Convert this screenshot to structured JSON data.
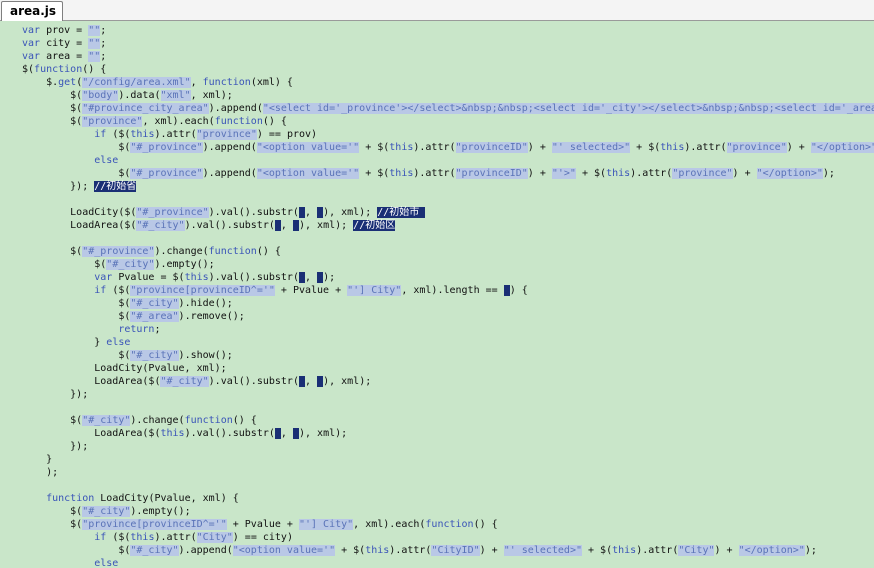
{
  "tab": {
    "title": "area.js"
  },
  "editor": {
    "lines": [
      [
        [
          "k",
          "var"
        ],
        [
          "p",
          " prov = "
        ],
        [
          "s",
          "\"\""
        ],
        [
          "p",
          ";"
        ]
      ],
      [
        [
          "k",
          "var"
        ],
        [
          "p",
          " city = "
        ],
        [
          "s",
          "\"\""
        ],
        [
          "p",
          ";"
        ]
      ],
      [
        [
          "k",
          "var"
        ],
        [
          "p",
          " area = "
        ],
        [
          "s",
          "\"\""
        ],
        [
          "p",
          ";"
        ]
      ],
      [
        [
          "p",
          "$("
        ],
        [
          "k",
          "function"
        ],
        [
          "p",
          "() {"
        ]
      ],
      [
        [
          "p",
          "    $."
        ],
        [
          "k",
          "get"
        ],
        [
          "p",
          "("
        ],
        [
          "s",
          "\"/config/area.xml\""
        ],
        [
          "p",
          ", "
        ],
        [
          "k",
          "function"
        ],
        [
          "p",
          "(xml) {"
        ]
      ],
      [
        [
          "p",
          "        $("
        ],
        [
          "s",
          "\"body\""
        ],
        [
          "p",
          ").data("
        ],
        [
          "s",
          "\"xml\""
        ],
        [
          "p",
          ", xml);"
        ]
      ],
      [
        [
          "p",
          "        $("
        ],
        [
          "s",
          "\"#province_city_area\""
        ],
        [
          "p",
          ").append("
        ],
        [
          "s",
          "\"<select id='_province'></select>&nbsp;&nbsp;<select id='_city'></select>&nbsp;&nbsp;<select id='_area'"
        ]
      ],
      [
        [
          "p",
          "        $("
        ],
        [
          "s",
          "\"province\""
        ],
        [
          "p",
          ", xml).each("
        ],
        [
          "k",
          "function"
        ],
        [
          "p",
          "() {"
        ]
      ],
      [
        [
          "p",
          "            "
        ],
        [
          "k",
          "if"
        ],
        [
          "p",
          " ($("
        ],
        [
          "k",
          "this"
        ],
        [
          "p",
          ").attr("
        ],
        [
          "s",
          "\"province\""
        ],
        [
          "p",
          ") == prov)"
        ]
      ],
      [
        [
          "p",
          "                $("
        ],
        [
          "s",
          "\"#_province\""
        ],
        [
          "p",
          ").append("
        ],
        [
          "s",
          "\"<option value='\""
        ],
        [
          "p",
          " + $("
        ],
        [
          "k",
          "this"
        ],
        [
          "p",
          ").attr("
        ],
        [
          "s",
          "\"provinceID\""
        ],
        [
          "p",
          ") + "
        ],
        [
          "s",
          "\"' selected>\""
        ],
        [
          "p",
          " + $("
        ],
        [
          "k",
          "this"
        ],
        [
          "p",
          ").attr("
        ],
        [
          "s",
          "\"province\""
        ],
        [
          "p",
          ") + "
        ],
        [
          "s",
          "\"</option>\""
        ],
        [
          "p",
          ");"
        ]
      ],
      [
        [
          "p",
          "            "
        ],
        [
          "k",
          "else"
        ]
      ],
      [
        [
          "p",
          "                $("
        ],
        [
          "s",
          "\"#_province\""
        ],
        [
          "p",
          ").append("
        ],
        [
          "s",
          "\"<option value='\""
        ],
        [
          "p",
          " + $("
        ],
        [
          "k",
          "this"
        ],
        [
          "p",
          ").attr("
        ],
        [
          "s",
          "\"provinceID\""
        ],
        [
          "p",
          ") + "
        ],
        [
          "s",
          "\"'>\""
        ],
        [
          "p",
          " + $("
        ],
        [
          "k",
          "this"
        ],
        [
          "p",
          ").attr("
        ],
        [
          "s",
          "\"province\""
        ],
        [
          "p",
          ") + "
        ],
        [
          "s",
          "\"</option>\""
        ],
        [
          "p",
          ");"
        ]
      ],
      [
        [
          "p",
          "        }); "
        ],
        [
          "cm",
          "//初始省"
        ]
      ],
      [],
      [
        [
          "p",
          "        LoadCity($("
        ],
        [
          "s",
          "\"#_province\""
        ],
        [
          "p",
          ").val().substr("
        ],
        [
          "m",
          "0"
        ],
        [
          "p",
          ", "
        ],
        [
          "m",
          "2"
        ],
        [
          "p",
          "), xml); "
        ],
        [
          "cm",
          "//初始市 "
        ]
      ],
      [
        [
          "p",
          "        LoadArea($("
        ],
        [
          "s",
          "\"#_city\""
        ],
        [
          "p",
          ").val().substr("
        ],
        [
          "m",
          "0"
        ],
        [
          "p",
          ", "
        ],
        [
          "m",
          "4"
        ],
        [
          "p",
          "), xml); "
        ],
        [
          "cm",
          "//初始区"
        ]
      ],
      [],
      [
        [
          "p",
          "        $("
        ],
        [
          "s",
          "\"#_province\""
        ],
        [
          "p",
          ").change("
        ],
        [
          "k",
          "function"
        ],
        [
          "p",
          "() {"
        ]
      ],
      [
        [
          "p",
          "            $("
        ],
        [
          "s",
          "\"#_city\""
        ],
        [
          "p",
          ").empty();"
        ]
      ],
      [
        [
          "p",
          "            "
        ],
        [
          "k",
          "var"
        ],
        [
          "p",
          " Pvalue = $("
        ],
        [
          "k",
          "this"
        ],
        [
          "p",
          ").val().substr("
        ],
        [
          "m",
          "0"
        ],
        [
          "p",
          ", "
        ],
        [
          "m",
          "2"
        ],
        [
          "p",
          ");"
        ]
      ],
      [
        [
          "p",
          "            "
        ],
        [
          "k",
          "if"
        ],
        [
          "p",
          " ($("
        ],
        [
          "s",
          "\"province[provinceID^='\""
        ],
        [
          "p",
          " + Pvalue + "
        ],
        [
          "s",
          "\"'] City\""
        ],
        [
          "p",
          ", xml).length == "
        ],
        [
          "m",
          "0"
        ],
        [
          "p",
          ") {"
        ]
      ],
      [
        [
          "p",
          "                $("
        ],
        [
          "s",
          "\"#_city\""
        ],
        [
          "p",
          ").hide();"
        ]
      ],
      [
        [
          "p",
          "                $("
        ],
        [
          "s",
          "\"#_area\""
        ],
        [
          "p",
          ").remove();"
        ]
      ],
      [
        [
          "p",
          "                "
        ],
        [
          "k",
          "return"
        ],
        [
          "p",
          ";"
        ]
      ],
      [
        [
          "p",
          "            } "
        ],
        [
          "k",
          "else"
        ]
      ],
      [
        [
          "p",
          "                $("
        ],
        [
          "s",
          "\"#_city\""
        ],
        [
          "p",
          ").show();"
        ]
      ],
      [
        [
          "p",
          "            LoadCity(Pvalue, xml);"
        ]
      ],
      [
        [
          "p",
          "            LoadArea($("
        ],
        [
          "s",
          "\"#_city\""
        ],
        [
          "p",
          ").val().substr("
        ],
        [
          "m",
          "0"
        ],
        [
          "p",
          ", "
        ],
        [
          "m",
          "4"
        ],
        [
          "p",
          "), xml);"
        ]
      ],
      [
        [
          "p",
          "        });"
        ]
      ],
      [],
      [
        [
          "p",
          "        $("
        ],
        [
          "s",
          "\"#_city\""
        ],
        [
          "p",
          ").change("
        ],
        [
          "k",
          "function"
        ],
        [
          "p",
          "() {"
        ]
      ],
      [
        [
          "p",
          "            LoadArea($("
        ],
        [
          "k",
          "this"
        ],
        [
          "p",
          ").val().substr("
        ],
        [
          "m",
          "0"
        ],
        [
          "p",
          ", "
        ],
        [
          "m",
          "4"
        ],
        [
          "p",
          "), xml);"
        ]
      ],
      [
        [
          "p",
          "        });"
        ]
      ],
      [
        [
          "p",
          "    }"
        ]
      ],
      [
        [
          "p",
          "    );"
        ]
      ],
      [],
      [
        [
          "p",
          "    "
        ],
        [
          "k",
          "function"
        ],
        [
          "p",
          " LoadCity(Pvalue, xml) {"
        ]
      ],
      [
        [
          "p",
          "        $("
        ],
        [
          "s",
          "\"#_city\""
        ],
        [
          "p",
          ").empty();"
        ]
      ],
      [
        [
          "p",
          "        $("
        ],
        [
          "s",
          "\"province[provinceID^='\""
        ],
        [
          "p",
          " + Pvalue + "
        ],
        [
          "s",
          "\"'] City\""
        ],
        [
          "p",
          ", xml).each("
        ],
        [
          "k",
          "function"
        ],
        [
          "p",
          "() {"
        ]
      ],
      [
        [
          "p",
          "            "
        ],
        [
          "k",
          "if"
        ],
        [
          "p",
          " ($("
        ],
        [
          "k",
          "this"
        ],
        [
          "p",
          ").attr("
        ],
        [
          "s",
          "\"City\""
        ],
        [
          "p",
          ") == city)"
        ]
      ],
      [
        [
          "p",
          "                $("
        ],
        [
          "s",
          "\"#_city\""
        ],
        [
          "p",
          ").append("
        ],
        [
          "s",
          "\"<option value='\""
        ],
        [
          "p",
          " + $("
        ],
        [
          "k",
          "this"
        ],
        [
          "p",
          ").attr("
        ],
        [
          "s",
          "\"CityID\""
        ],
        [
          "p",
          ") + "
        ],
        [
          "s",
          "\"' selected>\""
        ],
        [
          "p",
          " + $("
        ],
        [
          "k",
          "this"
        ],
        [
          "p",
          ").attr("
        ],
        [
          "s",
          "\"City\""
        ],
        [
          "p",
          ") + "
        ],
        [
          "s",
          "\"</option>\""
        ],
        [
          "p",
          ");"
        ]
      ],
      [
        [
          "p",
          "            "
        ],
        [
          "k",
          "else"
        ]
      ]
    ]
  }
}
